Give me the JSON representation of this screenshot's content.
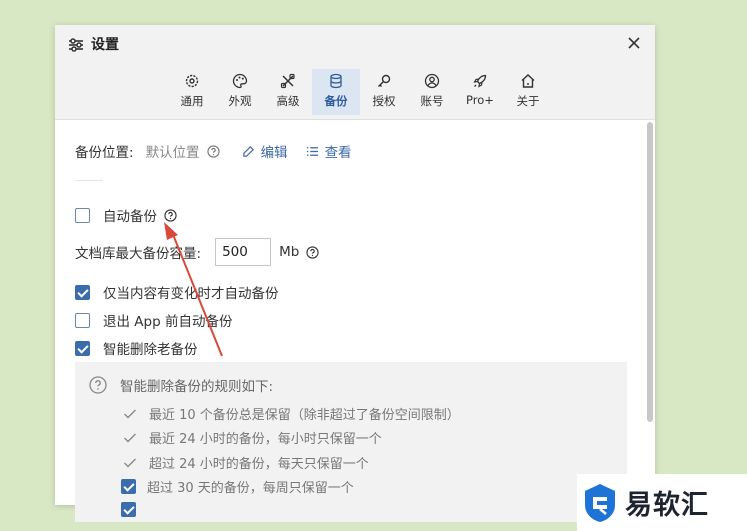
{
  "dialog": {
    "title": "设置",
    "tabs": [
      {
        "label": "通用",
        "icon": "gear-icon"
      },
      {
        "label": "外观",
        "icon": "palette-icon"
      },
      {
        "label": "高级",
        "icon": "tools-icon"
      },
      {
        "label": "备份",
        "icon": "database-icon",
        "active": true
      },
      {
        "label": "授权",
        "icon": "key-icon"
      },
      {
        "label": "账号",
        "icon": "user-icon"
      },
      {
        "label": "Pro+",
        "icon": "rocket-icon"
      },
      {
        "label": "关于",
        "icon": "home-icon"
      }
    ]
  },
  "backup": {
    "location_label": "备份位置:",
    "location_value": "默认位置",
    "edit_label": "编辑",
    "view_label": "查看",
    "auto_backup_label": "自动备份",
    "max_capacity_label": "文档库最大备份容量:",
    "max_capacity_value": "500",
    "max_capacity_unit": "Mb",
    "only_on_change_label": "仅当内容有变化时才自动备份",
    "only_on_change_checked": true,
    "backup_before_exit_label": "退出 App 前自动备份",
    "backup_before_exit_checked": false,
    "smart_delete_label": "智能删除老备份",
    "smart_delete_checked": true,
    "auto_backup_checked": false
  },
  "rules": {
    "heading": "智能删除备份的规则如下:",
    "items": [
      "最近 10 个备份总是保留（除非超过了备份空间限制）",
      "最近 24 小时的备份，每小时只保留一个",
      "超过 24 小时的备份，每天只保留一个",
      "超过 30 天的备份，每周只保留一个"
    ]
  },
  "watermark": {
    "text": "易软汇"
  },
  "colors": {
    "accent": "#3b6cab",
    "background": "#d9e8c4",
    "arrow": "#d9483b"
  }
}
